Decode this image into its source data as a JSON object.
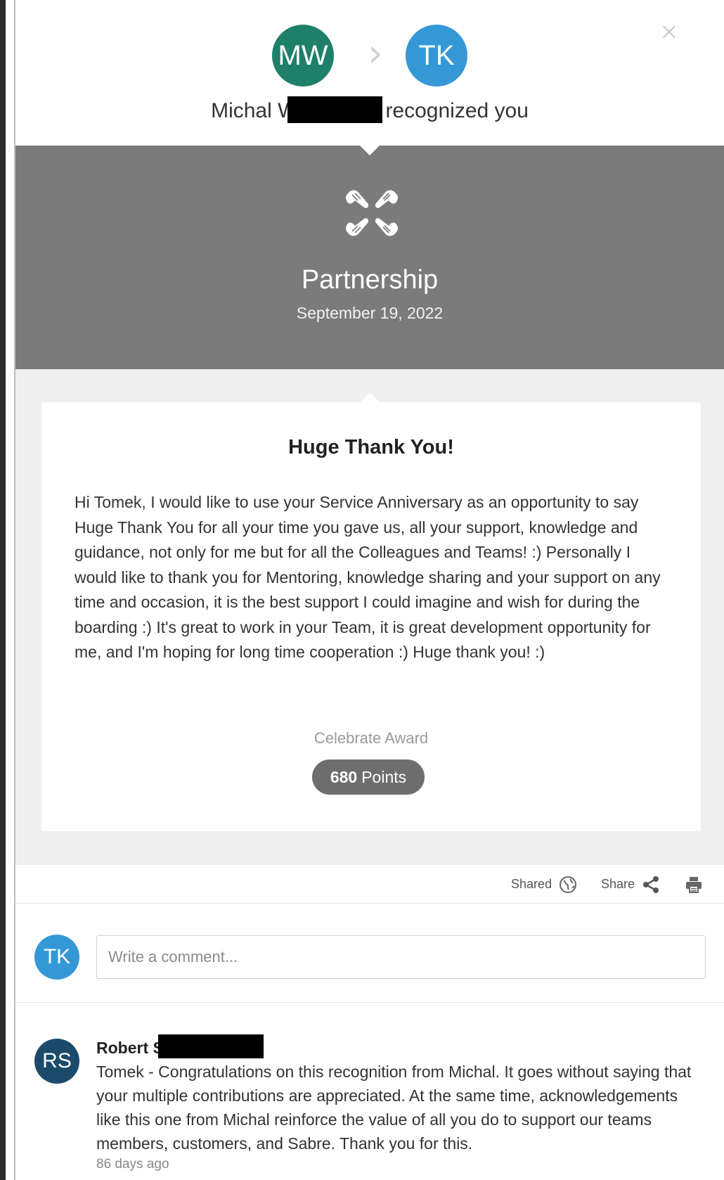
{
  "header": {
    "giver_initials": "MW",
    "receiver_initials": "TK",
    "giver_name_visible": "Michal W",
    "recognized_text": "recognized you",
    "close_symbol": "×"
  },
  "award": {
    "name": "Partnership",
    "date": "September 19, 2022",
    "icon": "partnership-hands-icon"
  },
  "message": {
    "title": "Huge Thank You!",
    "body": "Hi Tomek, I would like to use your Service Anniversary as an opportunity to say Huge Thank You for all your time you gave us, all your support, knowledge and guidance, not only for me but for all the Colleagues and Teams! :) Personally I would like to thank you for Mentoring, knowledge sharing and your support on any time and occasion, it is the best support I could imagine and wish for during the boarding :) It's great to work in your Team, it is great development opportunity for me, and I'm hoping for long time cooperation :) Huge thank you! :)",
    "celebrate_label": "Celebrate Award",
    "points_value": "680",
    "points_label": "Points"
  },
  "actions": {
    "shared_label": "Shared",
    "share_label": "Share"
  },
  "comment_input": {
    "avatar_initials": "TK",
    "placeholder": "Write a comment..."
  },
  "comments": [
    {
      "avatar_initials": "RS",
      "author_visible": "Robert S",
      "text": "Tomek - Congratulations on this recognition from Michal. It goes without saying that your multiple contributions are appreciated. At the same time, acknowledgements like this one from Michal reinforce the value of all you do to support our teams members, customers, and Sabre. Thank you for this.",
      "time": "86 days ago"
    }
  ],
  "colors": {
    "giver_avatar": "#1f8069",
    "receiver_avatar": "#3598d6",
    "commenter_avatar": "#1b4a6b",
    "award_band": "#7b7b7b",
    "message_background": "#efefef",
    "points_pill": "#6e6e6e"
  }
}
